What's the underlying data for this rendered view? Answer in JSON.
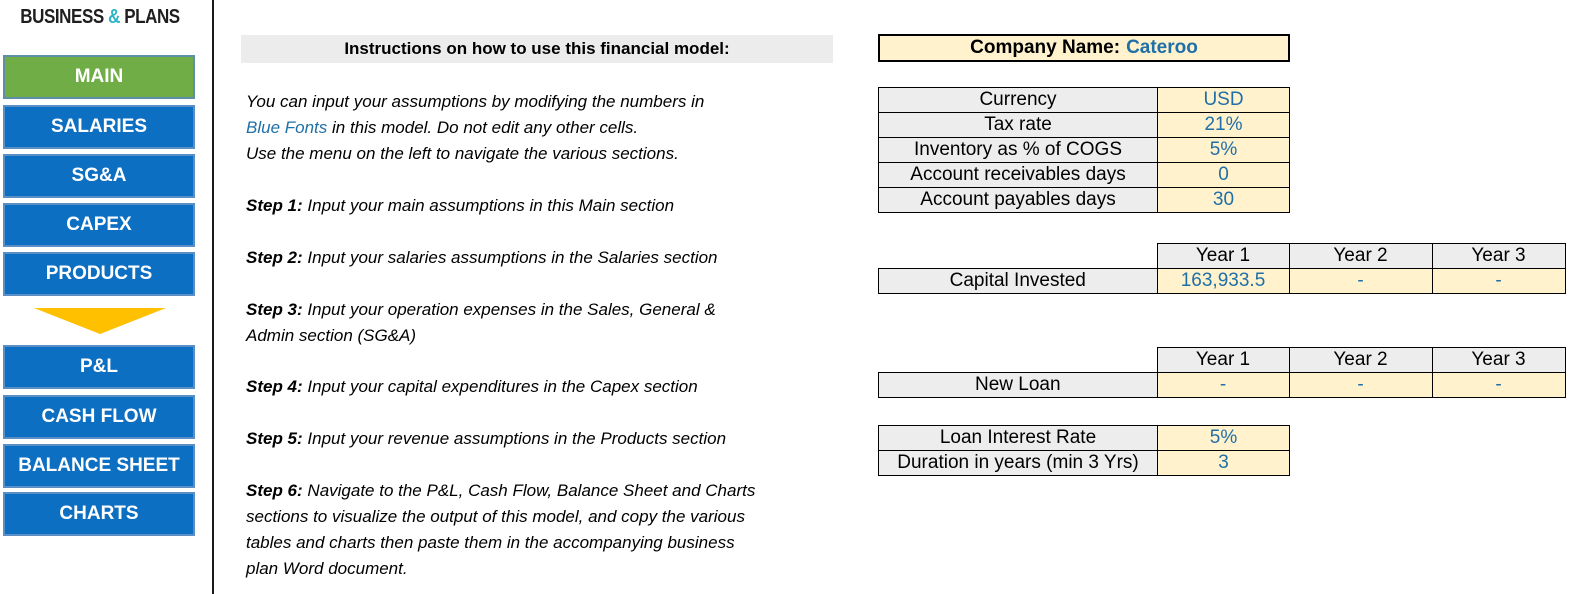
{
  "logo": {
    "part1": "BUSINESS ",
    "amp": "&",
    "part2": " PLANS"
  },
  "sidebar": {
    "items": [
      {
        "label": "MAIN",
        "active": true
      },
      {
        "label": "SALARIES"
      },
      {
        "label": "SG&A"
      },
      {
        "label": "CAPEX"
      },
      {
        "label": "PRODUCTS"
      },
      {
        "label": "P&L"
      },
      {
        "label": "CASH FLOW"
      },
      {
        "label": "BALANCE SHEET"
      },
      {
        "label": "CHARTS"
      }
    ]
  },
  "instructions": {
    "header": "Instructions on how to use this financial model:",
    "intro_line1": "You can input your assumptions by modifying the numbers in",
    "intro_blue": "Blue Fonts",
    "intro_line2_rest": " in this model. Do not edit any other cells.",
    "intro_line3": "Use the menu on the left to navigate the various sections.",
    "steps": [
      {
        "label": "Step 1:",
        "text": " Input your main assumptions in this Main section"
      },
      {
        "label": "Step 2:",
        "text": " Input your salaries assumptions in the Salaries section"
      },
      {
        "label": "Step 3:",
        "text": " Input your operation expenses in the Sales, General &",
        "text2": "Admin section (SG&A)"
      },
      {
        "label": "Step 4:",
        "text": " Input your capital expenditures in the Capex section"
      },
      {
        "label": "Step 5:",
        "text": " Input your revenue assumptions in the Products section"
      },
      {
        "label": "Step 6:",
        "text": " Navigate to the P&L, Cash Flow, Balance Sheet and Charts",
        "text2": "sections to visualize the output of this model, and copy the various",
        "text3": "tables and charts then paste them in the accompanying business",
        "text4": "plan Word document."
      }
    ]
  },
  "company": {
    "label": "Company Name:",
    "value": "Cateroo"
  },
  "assumptions": [
    {
      "label": "Currency",
      "value": "USD"
    },
    {
      "label": "Tax rate",
      "value": "21%"
    },
    {
      "label": "Inventory as % of COGS",
      "value": "5%"
    },
    {
      "label": "Account receivables days",
      "value": "0"
    },
    {
      "label": "Account payables days",
      "value": "30"
    }
  ],
  "capital": {
    "years": [
      "Year 1",
      "Year 2",
      "Year 3"
    ],
    "label": "Capital Invested",
    "values": [
      "163,933.5",
      "-",
      "-"
    ]
  },
  "loan": {
    "years": [
      "Year 1",
      "Year 2",
      "Year 3"
    ],
    "label": "New Loan",
    "values": [
      "-",
      "-",
      "-"
    ]
  },
  "loan_terms": [
    {
      "label": "Loan Interest Rate",
      "value": "5%"
    },
    {
      "label": "Duration in years (min 3 Yrs)",
      "value": "3"
    }
  ],
  "colors": {
    "nav_blue": "#0d6fc2",
    "nav_active": "#70ad47",
    "input_bg": "#fff2cc",
    "input_font": "#1f6fa8",
    "arrow": "#ffc000"
  }
}
